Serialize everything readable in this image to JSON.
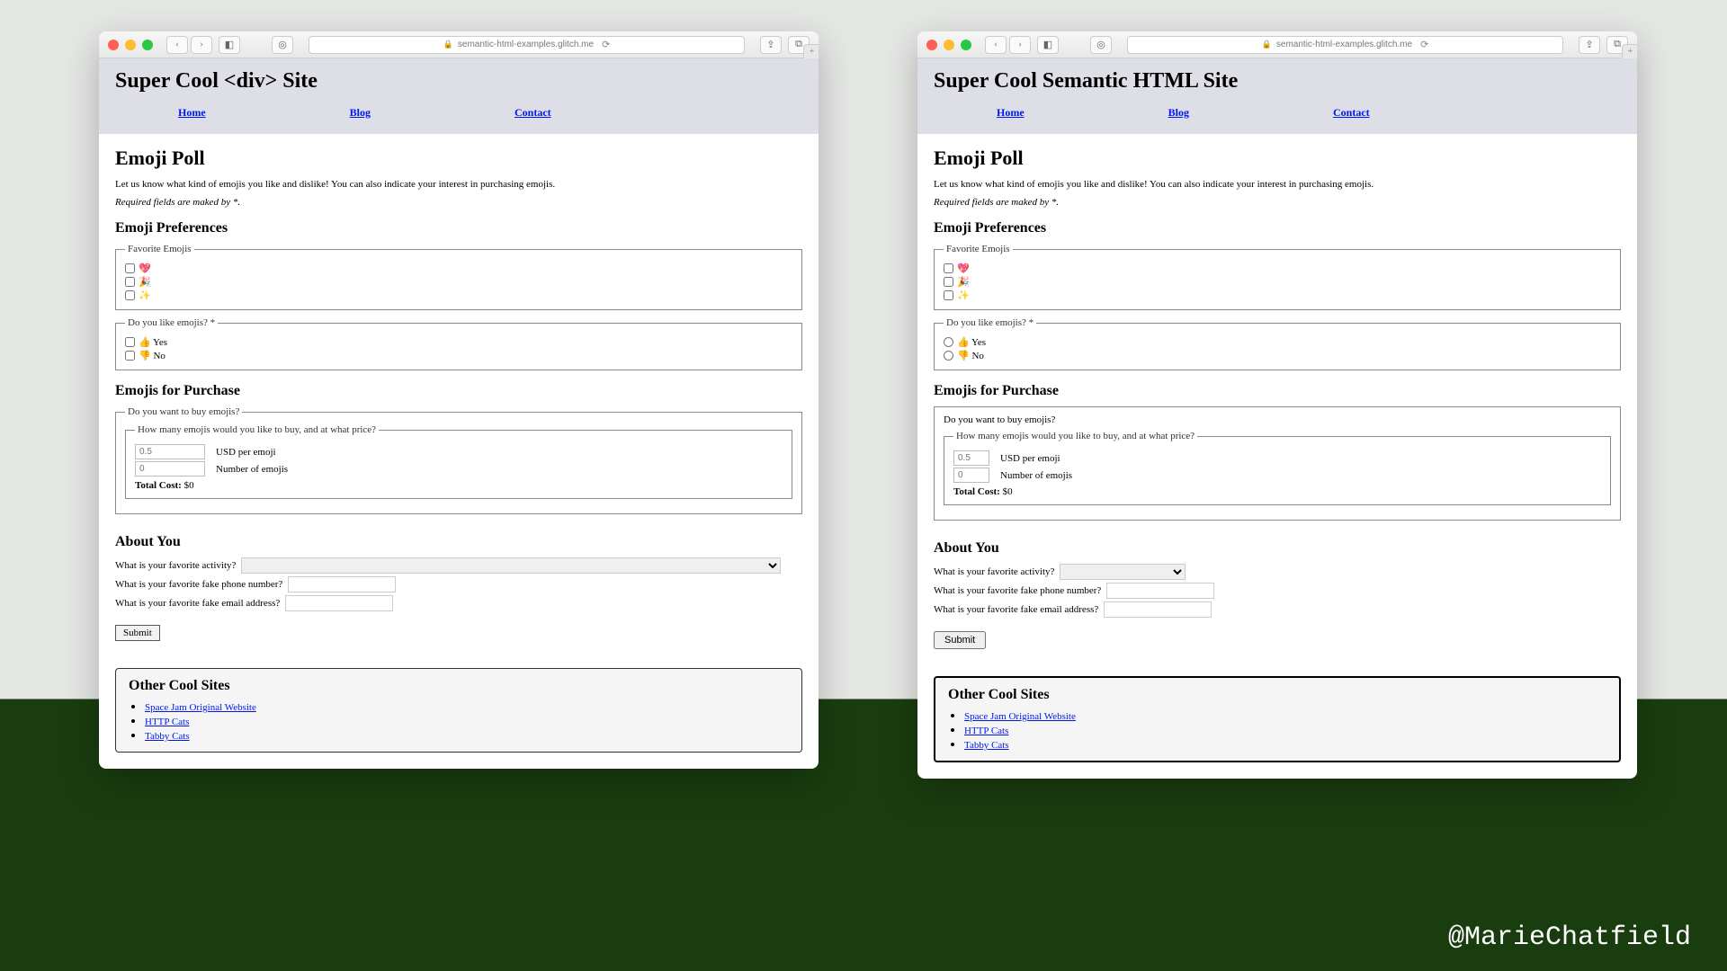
{
  "browser": {
    "url": "semantic-html-examples.glitch.me"
  },
  "nav": {
    "home": "Home",
    "blog": "Blog",
    "contact": "Contact"
  },
  "left": {
    "site_title": "Super Cool <div> Site"
  },
  "right": {
    "site_title": "Super Cool Semantic HTML Site"
  },
  "poll": {
    "title": "Emoji Poll",
    "desc": "Let us know what kind of emojis you like and dislike! You can also indicate your interest in purchasing emojis.",
    "required": "Required fields are maked by *.",
    "prefs_heading": "Emoji Preferences",
    "fav_legend": "Favorite Emojis",
    "fav_options": [
      "💖",
      "🎉",
      "✨"
    ],
    "like_legend": "Do you like emojis? *",
    "like_yes": "👍 Yes",
    "like_no": "👎 No",
    "purchase_heading": "Emojis for Purchase",
    "want_legend": "Do you want to buy emojis?",
    "howmany_legend": "How many emojis would you like to buy, and at what price?",
    "price_placeholder": "0.5",
    "price_label": "USD per emoji",
    "count_placeholder": "0",
    "count_label": "Number of emojis",
    "total_label": "Total Cost:",
    "total_value": "$0",
    "about_heading": "About You",
    "q_activity": "What is your favorite activity?",
    "q_phone": "What is your favorite fake phone number?",
    "q_email": "What is your favorite fake email address?",
    "submit": "Submit"
  },
  "other": {
    "heading": "Other Cool Sites",
    "links": {
      "spacejam": "Space Jam Original Website",
      "httpcats": "HTTP Cats",
      "tabbycats": "Tabby Cats"
    }
  },
  "handle": "@MarieChatfield"
}
